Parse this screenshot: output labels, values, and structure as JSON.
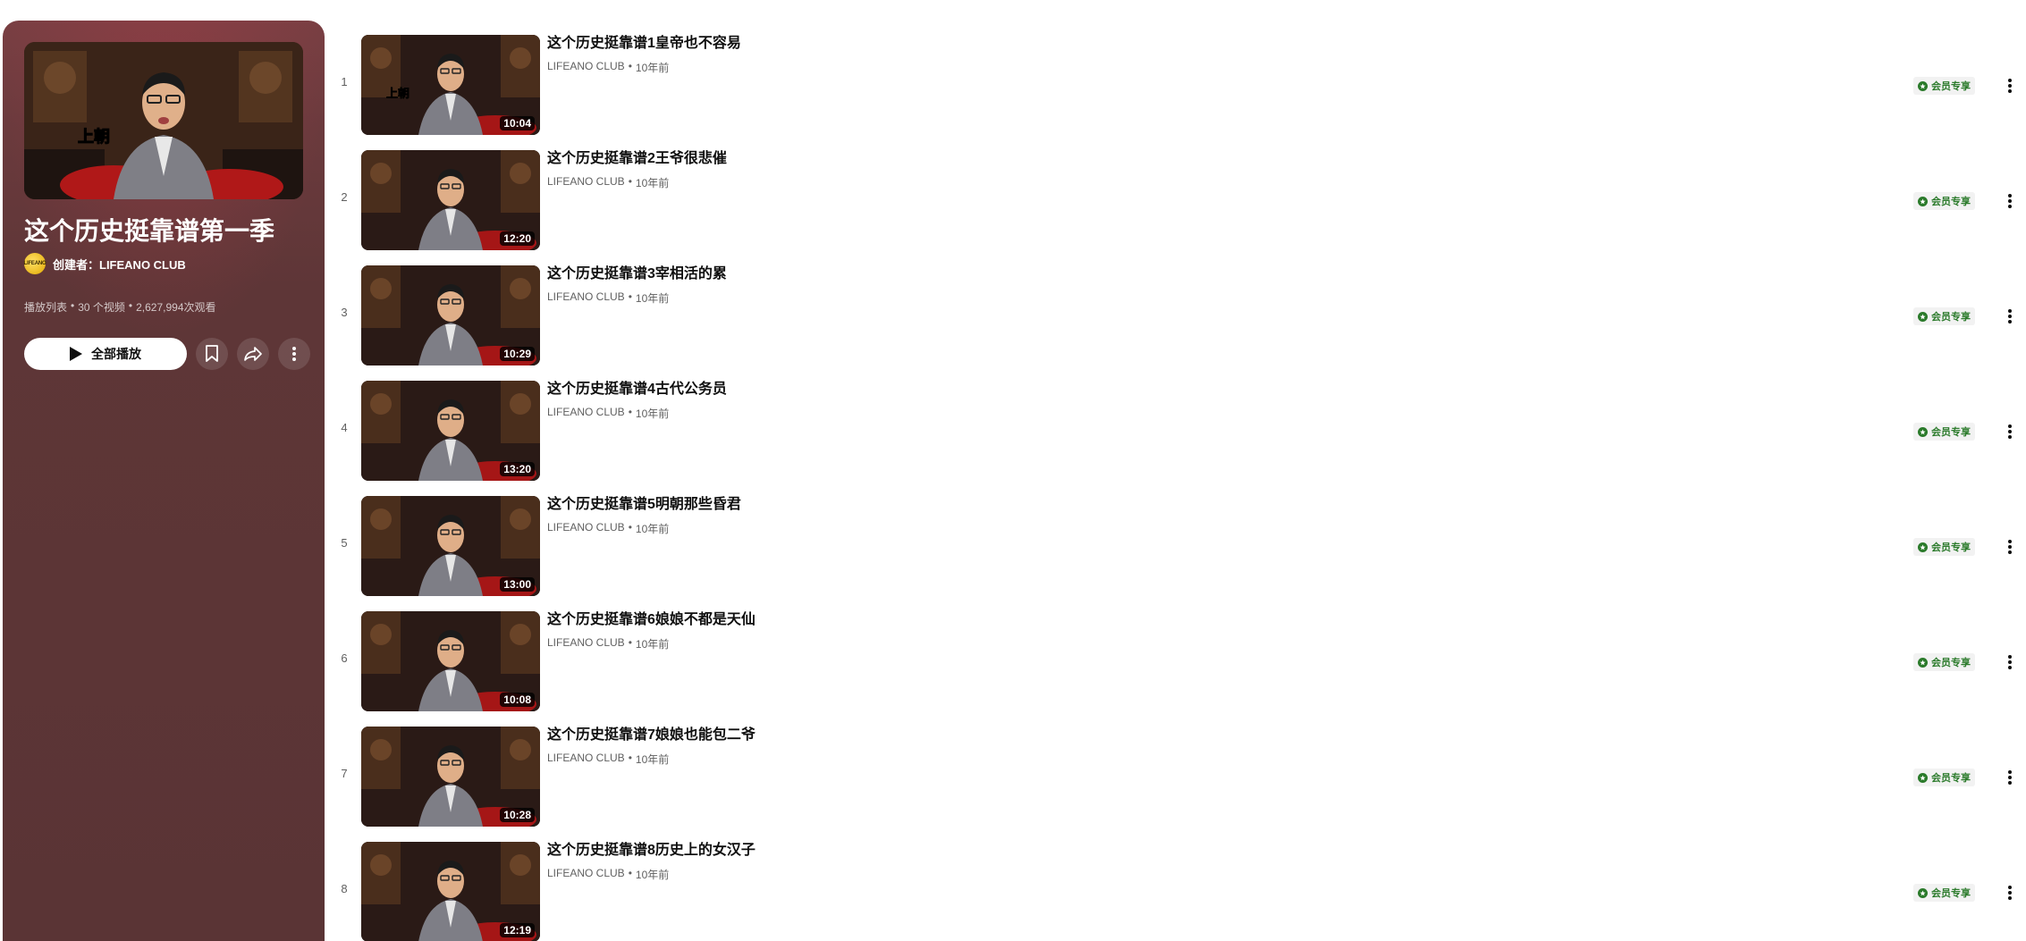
{
  "playlist": {
    "title": "这个历史挺靠谱第一季",
    "creator": "创建者：LIFEANO CLUB",
    "avatar_text": "LIFEANO",
    "type": "播放列表",
    "video_count": "30 个视频",
    "views": "2,627,994次观看",
    "separator": "•",
    "play_all": "全部播放",
    "colors": {
      "panel": "#5e3637",
      "accent": "#ffffff"
    }
  },
  "videos": [
    {
      "index": "1",
      "title": "这个历史挺靠谱1皇帝也不容易",
      "channel": "LIFEANO CLUB",
      "age": "10年前",
      "duration": "10:04",
      "badge": "会员专享",
      "thumb_caption": "上朝"
    },
    {
      "index": "2",
      "title": "这个历史挺靠谱2王爷很悲催",
      "channel": "LIFEANO CLUB",
      "age": "10年前",
      "duration": "12:20",
      "badge": "会员专享",
      "thumb_caption": ""
    },
    {
      "index": "3",
      "title": "这个历史挺靠谱3宰相活的累",
      "channel": "LIFEANO CLUB",
      "age": "10年前",
      "duration": "10:29",
      "badge": "会员专享",
      "thumb_caption": ""
    },
    {
      "index": "4",
      "title": "这个历史挺靠谱4古代公务员",
      "channel": "LIFEANO CLUB",
      "age": "10年前",
      "duration": "13:20",
      "badge": "会员专享",
      "thumb_caption": ""
    },
    {
      "index": "5",
      "title": "这个历史挺靠谱5明朝那些昏君",
      "channel": "LIFEANO CLUB",
      "age": "10年前",
      "duration": "13:00",
      "badge": "会员专享",
      "thumb_caption": ""
    },
    {
      "index": "6",
      "title": "这个历史挺靠谱6娘娘不都是天仙",
      "channel": "LIFEANO CLUB",
      "age": "10年前",
      "duration": "10:08",
      "badge": "会员专享",
      "thumb_caption": ""
    },
    {
      "index": "7",
      "title": "这个历史挺靠谱7娘娘也能包二爷",
      "channel": "LIFEANO CLUB",
      "age": "10年前",
      "duration": "10:28",
      "badge": "会员专享",
      "thumb_caption": ""
    },
    {
      "index": "8",
      "title": "这个历史挺靠谱8历史上的女汉子",
      "channel": "LIFEANO CLUB",
      "age": "10年前",
      "duration": "12:19",
      "badge": "会员专享",
      "thumb_caption": ""
    }
  ]
}
